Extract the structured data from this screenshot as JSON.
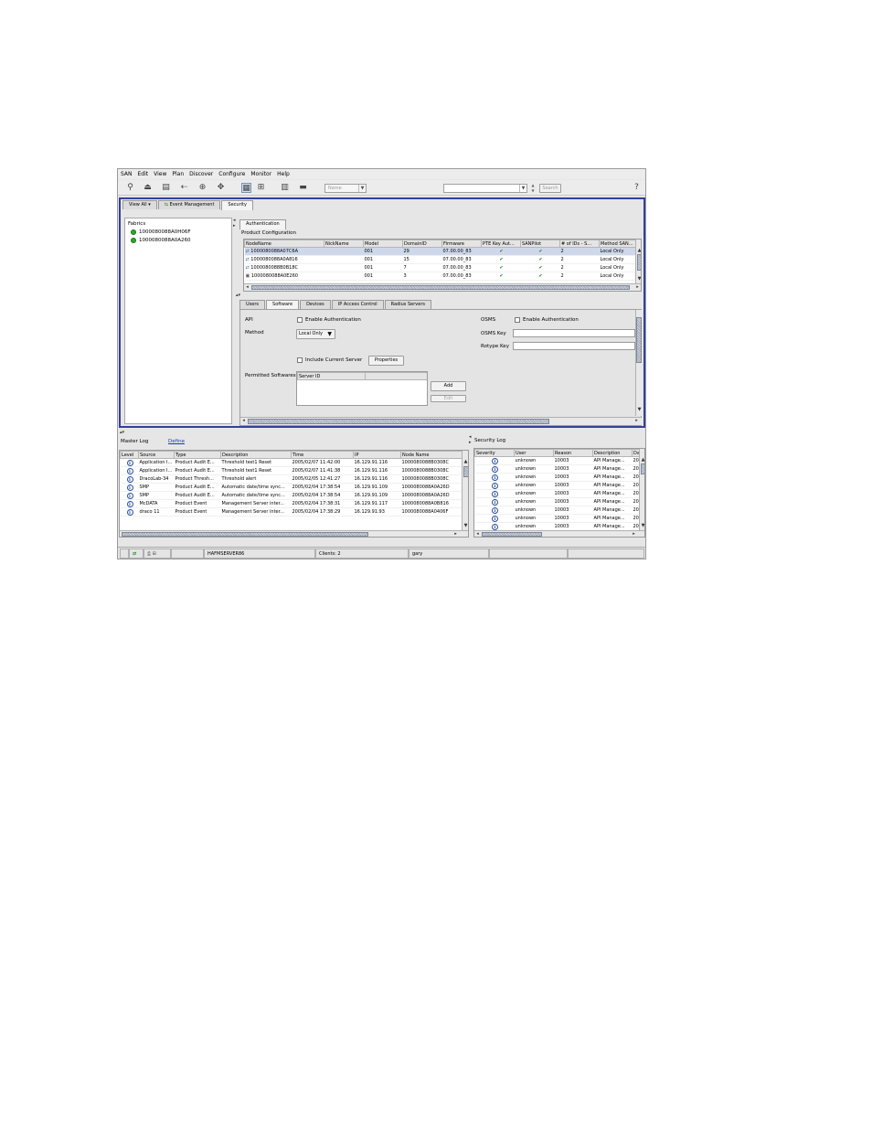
{
  "menu": [
    "SAN",
    "Edit",
    "View",
    "Plan",
    "Discover",
    "Configure",
    "Monitor",
    "Help"
  ],
  "toolbar": {
    "name_combo": "Name",
    "search_value": "",
    "search_button": "Search",
    "help_icon": "?"
  },
  "top_tabs": [
    "View All",
    "Event Management",
    "Security"
  ],
  "fabrics": {
    "title": "Fabrics",
    "items": [
      "1000080088A0H06F",
      "1000080088A0A260"
    ]
  },
  "security": {
    "tab": "Authentication",
    "section": "Product Configuration",
    "columns": [
      "NodeName",
      "NickName",
      "Model",
      "DomainID",
      "Firmware",
      "PTE Key Aut...",
      "SANPilot",
      "# of IDs - S...",
      "Method SAN..."
    ],
    "rows": [
      [
        "1000080088A07C6A",
        "",
        "001",
        "29",
        "07.00.00_83",
        "✔",
        "✔",
        "2",
        "Local Only"
      ],
      [
        "1000080088A0A816",
        "",
        "001",
        "15",
        "07.00.00_83",
        "✔",
        "✔",
        "2",
        "Local Only"
      ],
      [
        "1000080088B0B18C",
        "",
        "001",
        "7",
        "07.00.00_83",
        "✔",
        "✔",
        "2",
        "Local Only"
      ],
      [
        "1000080088A0E260",
        "",
        "001",
        "3",
        "07.00.00_83",
        "✔",
        "✔",
        "2",
        "Local Only"
      ]
    ],
    "sub_tabs": [
      "Users",
      "Software",
      "Devices",
      "IP Access Control",
      "Radius Servers"
    ],
    "api_label": "API",
    "enable_auth": "Enable Authentication",
    "method_label": "Method",
    "method_value": "Local Only",
    "osms_label": "OSMS",
    "osms_enable": "Enable Authentication",
    "osms_key_label": "OSMS Key",
    "rotype_key_label": "Rotype Key",
    "include_server": "Include Current Server",
    "properties_button": "Properties",
    "permitted_label": "Permitted Softwares",
    "server_id_header": "Server ID",
    "add_button": "Add",
    "edit_button": "Edit"
  },
  "master_log": {
    "title": "Master Log",
    "define_link": "Define",
    "columns": [
      "Level",
      "Source",
      "Type",
      "Description",
      "Time",
      "IP",
      "Node Name"
    ],
    "rows": [
      [
        "Application I...",
        "Product Audit E...",
        "Threshold test1 Reset",
        "2005/02/07 11:42:00",
        "16.129.91.116",
        "1000080088B0308C"
      ],
      [
        "Application I...",
        "Product Audit E...",
        "Threshold test1 Reset",
        "2005/02/07 11:41:38",
        "16.129.91.116",
        "1000080088B0308C"
      ],
      [
        "DracoLab-34",
        "Product Thresh...",
        "Threshold alert",
        "2005/02/05 12:41:27",
        "16.129.91.116",
        "1000080088B0308C"
      ],
      [
        "SMP",
        "Product Audit E...",
        "Automatic date/time sync...",
        "2005/02/04 17:38:54",
        "16.129.91.109",
        "1000080088A0A26D"
      ],
      [
        "SMP",
        "Product Audit E...",
        "Automatic date/time sync...",
        "2005/02/04 17:38:54",
        "16.129.91.109",
        "1000080088A0A26D"
      ],
      [
        "McDATA",
        "Product Event",
        "Management Server inter...",
        "2005/02/04 17:38:31",
        "16.129.91.117",
        "1000080088A0B816"
      ],
      [
        "draco 11",
        "Product Event",
        "Management Server inter...",
        "2005/02/04 17:38:29",
        "16.129.91.93",
        "1000080088A0406F"
      ]
    ]
  },
  "security_log": {
    "title": "Security Log",
    "columns": [
      "Severity",
      "User",
      "Reason",
      "Description",
      "Da"
    ],
    "rows": [
      [
        "unknown",
        "10003",
        "API Manage...",
        "20"
      ],
      [
        "unknown",
        "10003",
        "API Manage...",
        "20"
      ],
      [
        "unknown",
        "10003",
        "API Manage...",
        "20"
      ],
      [
        "unknown",
        "10003",
        "API Manage...",
        "20"
      ],
      [
        "unknown",
        "10003",
        "API Manage...",
        "20"
      ],
      [
        "unknown",
        "10003",
        "API Manage...",
        "20"
      ],
      [
        "unknown",
        "10003",
        "API Manage...",
        "20"
      ],
      [
        "unknown",
        "10003",
        "API Manage...",
        "20"
      ],
      [
        "unknown",
        "10003",
        "API Manage...",
        "20"
      ]
    ]
  },
  "status": {
    "server": "HAFMSERVER86",
    "clients": "Clients: 2",
    "user": "gary"
  }
}
